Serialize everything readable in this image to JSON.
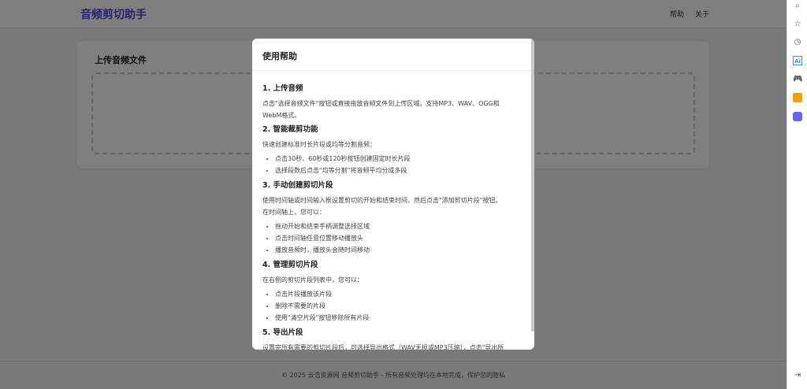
{
  "header": {
    "title": "音频剪切助手",
    "nav": [
      "帮助",
      "关于"
    ]
  },
  "upload": {
    "title": "上传音频文件"
  },
  "footer": {
    "text": "© 2025 云浩资源网 音频剪切助手 - 所有音频处理均在本地完成，保护您的隐私"
  },
  "modal": {
    "title": "使用帮助",
    "sections": [
      {
        "heading": "1. 上传音频",
        "text": "点击\"选择音频文件\"按钮或直接拖放音频文件到上传区域。支持MP3、WAV、OGG和WebM格式。"
      },
      {
        "heading": "2. 智能裁剪功能",
        "text": "快速创建标准时长片段或均等分割音频：",
        "items": [
          "点击30秒、60秒或120秒按钮创建固定时长片段",
          "选择段数后点击\"均等分割\"将音频平均分成多段"
        ]
      },
      {
        "heading": "3. 手动创建剪切片段",
        "text": "使用时间轴或时间输入框设置剪切的开始和结束时间，然后点击\"添加剪切片段\"按钮。",
        "text2": "在时间轴上，您可以：",
        "items": [
          "拖动开始和结束手柄调整选择区域",
          "点击时间轴任意位置移动播放头",
          "播放音频时，播放头会随时间移动"
        ]
      },
      {
        "heading": "4. 管理剪切片段",
        "text": "在右侧的剪切片段列表中，您可以：",
        "items": [
          "点击片段播放该片段",
          "删除不需要的片段",
          "使用\"清空片段\"按钮移除所有片段"
        ]
      },
      {
        "heading": "5. 导出片段",
        "text": "设置完所有需要的剪切片段后，可选择导出格式（WAV无损或MP3压缩），点击\"导出所"
      }
    ]
  },
  "sidebar": {
    "icons": [
      "search-icon",
      "star-icon",
      "history-icon",
      "ai-icon",
      "gamepad-icon",
      "toolbox-icon",
      "app-icon",
      "collapse-icon"
    ]
  },
  "colors": {
    "brand": "#4f46e5"
  }
}
